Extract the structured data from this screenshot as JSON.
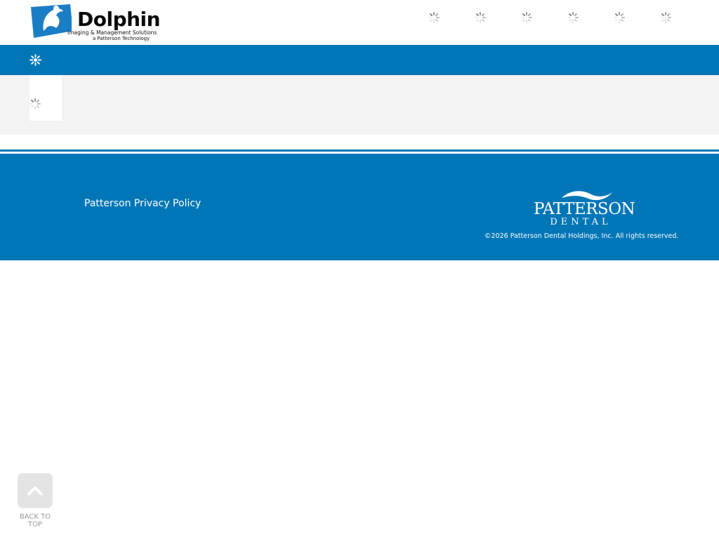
{
  "header": {
    "logo": {
      "name": "Dolphin",
      "tagline": "Imaging & Management Solutions",
      "tagline2": "a Patterson Technology"
    },
    "nav_items": [
      "loading-icon",
      "loading-icon",
      "loading-icon",
      "loading-icon",
      "loading-icon",
      "loading-icon"
    ]
  },
  "navbar": {
    "menu_icon": "loading-gear-icon"
  },
  "footer": {
    "privacy_link": "Patterson Privacy Policy",
    "patterson_logo": {
      "line1": "PATTERSON",
      "line2": "DENTAL"
    },
    "copyright": "©2026 Patterson Dental Holdings, Inc. All rights reserved."
  },
  "back_to_top": {
    "label": "BACK TO TOP"
  },
  "colors": {
    "brand_blue": "#0076b7",
    "band_grey": "#f3f3f3",
    "button_grey": "#e4e4e4"
  }
}
